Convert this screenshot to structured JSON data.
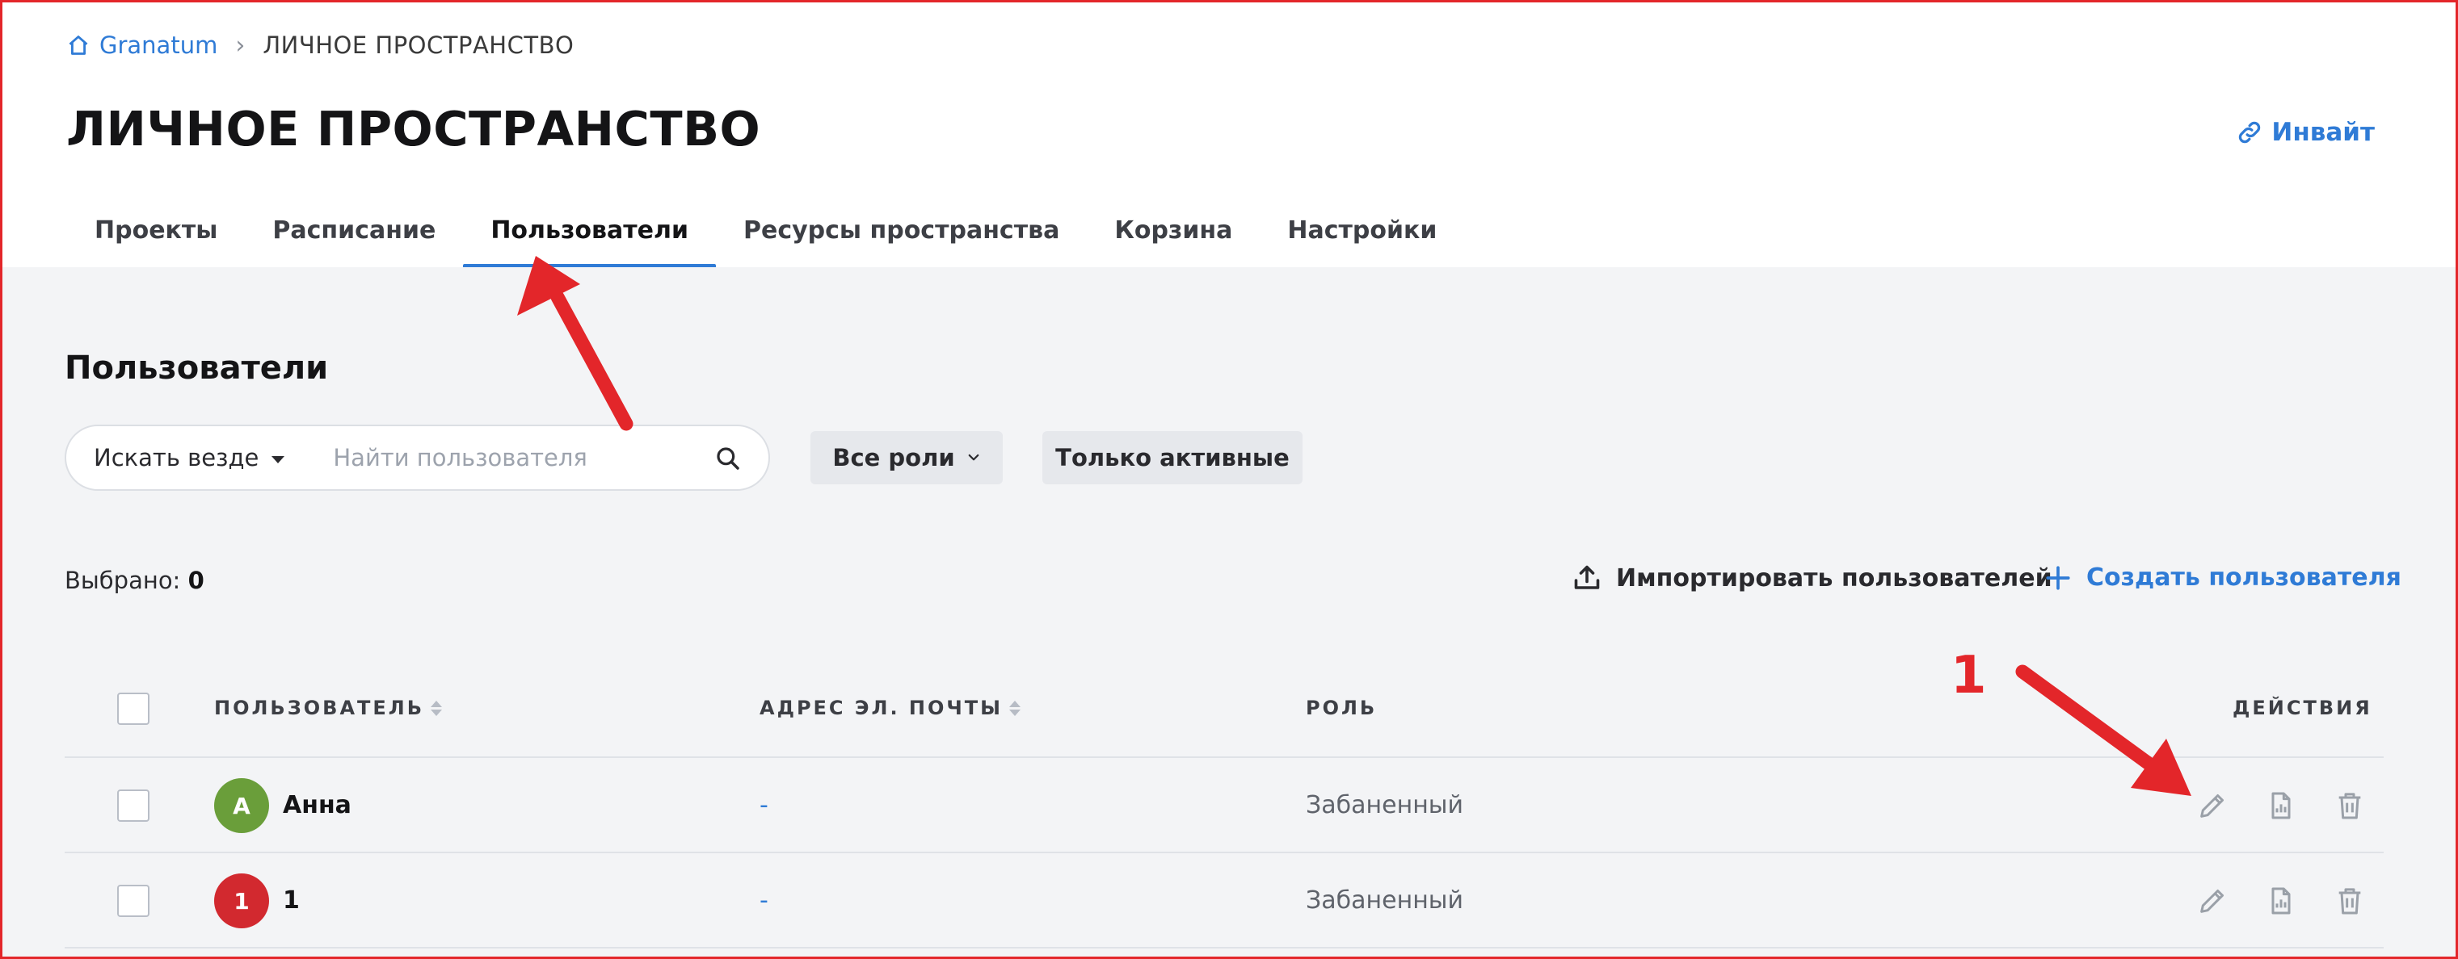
{
  "breadcrumb": {
    "home_label": "Granatum",
    "current": "ЛИЧНОЕ ПРОСТРАНСТВО"
  },
  "page": {
    "title": "ЛИЧНОЕ ПРОСТРАНСТВО",
    "invite_label": "Инвайт"
  },
  "tabs": [
    {
      "label": "Проекты",
      "active": false
    },
    {
      "label": "Расписание",
      "active": false
    },
    {
      "label": "Пользователи",
      "active": true
    },
    {
      "label": "Ресурсы пространства",
      "active": false
    },
    {
      "label": "Корзина",
      "active": false
    },
    {
      "label": "Настройки",
      "active": false
    }
  ],
  "section": {
    "title": "Пользователи"
  },
  "search": {
    "scope_label": "Искать везде",
    "placeholder": "Найти пользователя",
    "value": ""
  },
  "filters": {
    "roles_label": "Все роли",
    "active_only_label": "Только активные"
  },
  "toolbar": {
    "selected_label": "Выбрано:",
    "selected_count": "0",
    "import_label": "Импортировать пользователей",
    "create_label": "Создать пользователя"
  },
  "table": {
    "headers": {
      "user": "ПОЛЬЗОВАТЕЛЬ",
      "email": "АДРЕС ЭЛ. ПОЧТЫ",
      "role": "РОЛЬ",
      "actions": "ДЕЙСТВИЯ"
    },
    "rows": [
      {
        "avatar_letter": "А",
        "avatar_color": "#6a9e3a",
        "name": "Анна",
        "email": "-",
        "role": "Забаненный"
      },
      {
        "avatar_letter": "1",
        "avatar_color": "#d2292f",
        "name": "1",
        "email": "-",
        "role": "Забаненный"
      }
    ]
  },
  "annotation": {
    "number": "1",
    "color": "#e3262a"
  },
  "colors": {
    "accent": "#2f7bd6",
    "background": "#f3f4f6"
  }
}
